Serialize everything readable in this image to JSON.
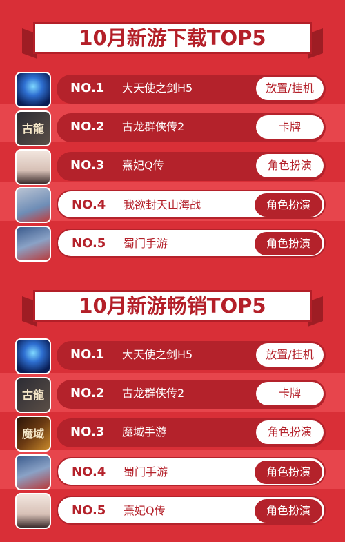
{
  "sections": [
    {
      "title": "10月新游下载TOP5",
      "rows": [
        {
          "rank": "NO.1",
          "name": "大天使之剑H5",
          "tag": "放置/挂机",
          "icon": "angel-wings-icon"
        },
        {
          "rank": "NO.2",
          "name": "古龙群侠传2",
          "tag": "卡牌",
          "icon": "gulong-logo-icon"
        },
        {
          "rank": "NO.3",
          "name": "熹妃Q传",
          "tag": "角色扮演",
          "icon": "consort-girl-icon"
        },
        {
          "rank": "NO.4",
          "name": "我欲封天山海战",
          "tag": "角色扮演",
          "icon": "hero-portrait-icon"
        },
        {
          "rank": "NO.5",
          "name": "蜀门手游",
          "tag": "角色扮演",
          "icon": "shumen-hero-icon"
        }
      ]
    },
    {
      "title": "10月新游畅销TOP5",
      "rows": [
        {
          "rank": "NO.1",
          "name": "大天使之剑H5",
          "tag": "放置/挂机",
          "icon": "angel-wings-icon"
        },
        {
          "rank": "NO.2",
          "name": "古龙群侠传2",
          "tag": "卡牌",
          "icon": "gulong-logo-icon"
        },
        {
          "rank": "NO.3",
          "name": "魔域手游",
          "tag": "角色扮演",
          "icon": "moyu-logo-icon"
        },
        {
          "rank": "NO.4",
          "name": "蜀门手游",
          "tag": "角色扮演",
          "icon": "shumen-hero-icon"
        },
        {
          "rank": "NO.5",
          "name": "熹妃Q传",
          "tag": "角色扮演",
          "icon": "consort-girl-icon"
        }
      ]
    }
  ],
  "icon_text": {
    "gulong": "古龍",
    "moyu": "魔域"
  },
  "colors": {
    "background": "#d92f37",
    "stripe": "#e7454c",
    "accent": "#b4222b",
    "white": "#ffffff"
  }
}
